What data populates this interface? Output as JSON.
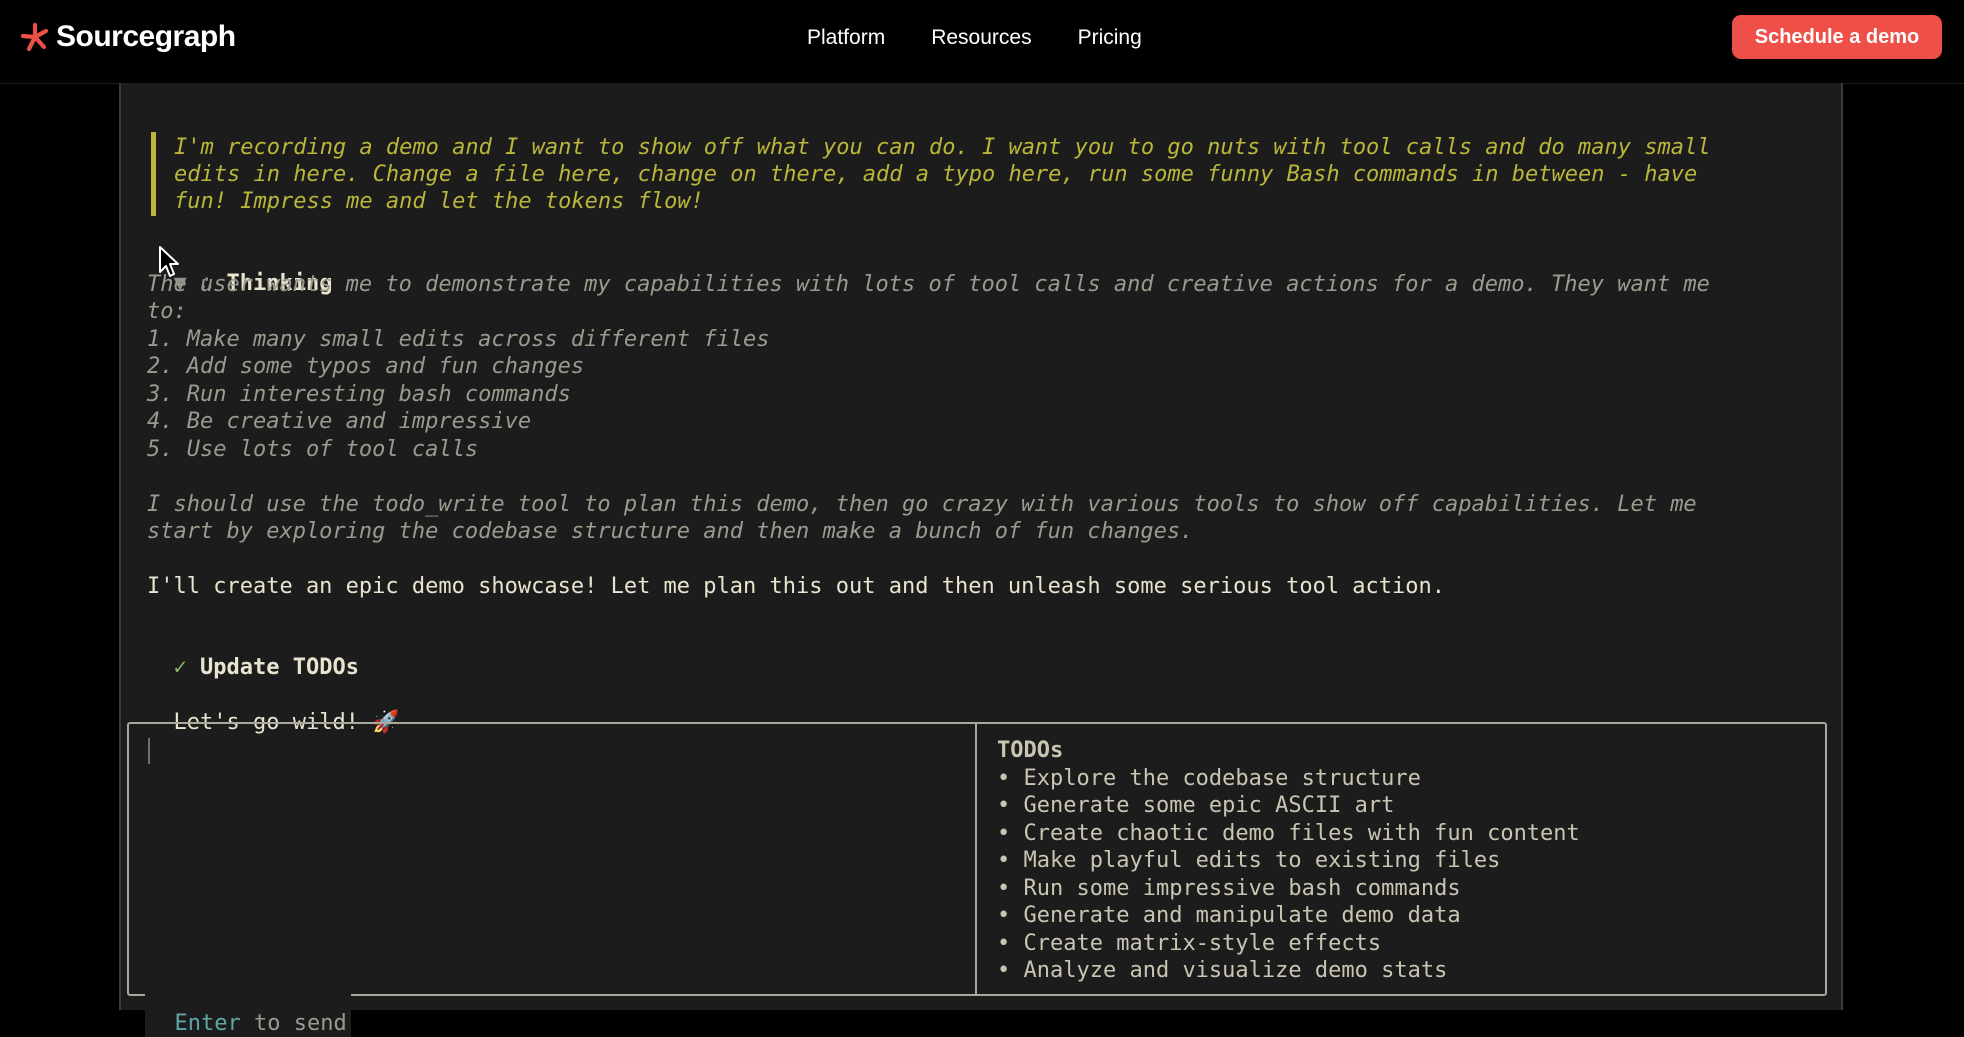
{
  "nav": {
    "brand": "Sourcegraph",
    "links": [
      "Platform",
      "Resources",
      "Pricing"
    ],
    "cta": "Schedule a demo"
  },
  "colors": {
    "accent": "#ee4f48",
    "quote": "#b9b63a",
    "check": "#8ab95d",
    "hint_key": "#5fa6a6"
  },
  "terminal": {
    "user_message": [
      "I'm recording a demo and I want to show off what you can do. I want you to go nuts with tool calls and do many small",
      "edits in here. Change a file here, change on there, add a typo here, run some funny Bash commands in between - have",
      "fun! Impress me and let the tokens flow!"
    ],
    "thinking_toggle": "▼",
    "thinking_glyph": "∴",
    "thinking_label": "Thinking",
    "thinking_lines": [
      "The user wants me to demonstrate my capabilities with lots of tool calls and creative actions for a demo. They want me",
      "to:",
      "1. Make many small edits across different files",
      "2. Add some typos and fun changes",
      "3. Run interesting bash commands",
      "4. Be creative and impressive",
      "5. Use lots of tool calls",
      "",
      "I should use the todo_write tool to plan this demo, then go crazy with various tools to show off capabilities. Let me",
      "start by exploring the codebase structure and then make a bunch of fun changes."
    ],
    "assistant_message": "I'll create an epic demo showcase! Let me plan this out and then unleash some serious tool action.",
    "tool_check": "✓",
    "tool_label": "Update TODOs",
    "final_message": "Let's go wild!",
    "final_emoji": "🚀"
  },
  "todos": {
    "title": "TODOs",
    "bullet": "•",
    "items": [
      "Explore the codebase structure",
      "Generate some epic ASCII art",
      "Create chaotic demo files with fun content",
      "Make playful edits to existing files",
      "Run some impressive bash commands",
      "Generate and manipulate demo data",
      "Create matrix-style effects",
      "Analyze and visualize demo stats"
    ]
  },
  "input": {
    "hint_key": "Enter",
    "hint_rest": " to send"
  }
}
